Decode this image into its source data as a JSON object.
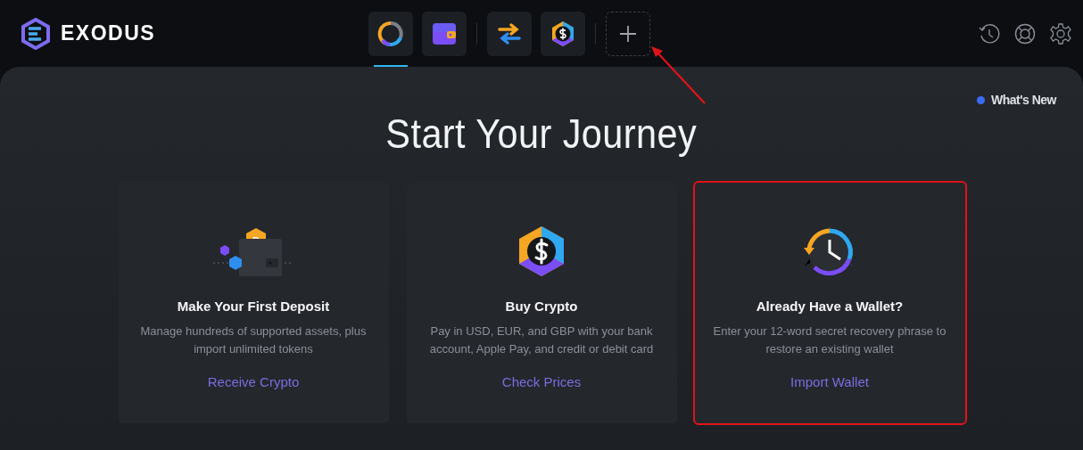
{
  "app": {
    "name": "EXODUS"
  },
  "nav": [
    {
      "kind": "portfolio",
      "selected": true,
      "divider_before": false
    },
    {
      "kind": "wallet",
      "selected": false,
      "divider_before": false
    },
    {
      "kind": "exchange",
      "selected": false,
      "divider_before": true
    },
    {
      "kind": "buy",
      "selected": false,
      "divider_before": false
    },
    {
      "kind": "add",
      "selected": false,
      "divider_before": true
    }
  ],
  "toolbar": [
    {
      "kind": "history"
    },
    {
      "kind": "support"
    },
    {
      "kind": "settings"
    }
  ],
  "whats_new": {
    "label": "What's New",
    "color": "#3b6cf6"
  },
  "title": "Start Your Journey",
  "cards": [
    {
      "kind": "deposit",
      "title": "Make Your First Deposit",
      "text": "Manage hundreds of supported assets, plus import unlimited tokens",
      "link": "Receive Crypto",
      "highlighted": false
    },
    {
      "kind": "buy",
      "title": "Buy Crypto",
      "text": "Pay in USD, EUR, and GBP with your bank account, Apple Pay, and credit or debit card",
      "link": "Check Prices",
      "highlighted": false
    },
    {
      "kind": "restore",
      "title": "Already Have a Wallet?",
      "text": "Enter your 12-word secret recovery phrase to restore an existing wallet",
      "link": "Import Wallet",
      "highlighted": true
    }
  ],
  "annotation_arrow": true
}
